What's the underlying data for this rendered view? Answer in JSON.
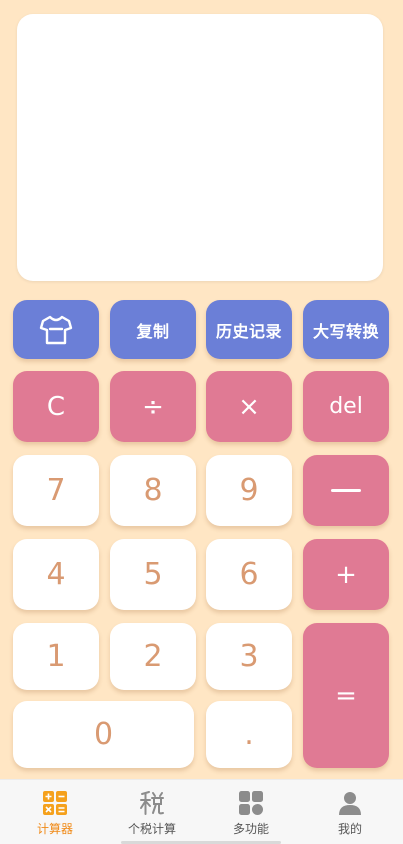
{
  "display": {
    "expression": "",
    "result": ""
  },
  "toolbar": {
    "skin_icon": "tshirt-icon",
    "copy_label": "复制",
    "history_label": "历史记录",
    "uppercase_label": "大写转换"
  },
  "keys": {
    "clear": "C",
    "divide": "÷",
    "multiply": "×",
    "delete": "del",
    "minus_icon": "minus-bar",
    "plus": "+",
    "equals": "=",
    "dot": ".",
    "digits": [
      "7",
      "8",
      "9",
      "4",
      "5",
      "6",
      "1",
      "2",
      "3",
      "0"
    ]
  },
  "tabbar": {
    "tabs": [
      {
        "label": "计算器",
        "icon": "calculator-icon",
        "active": true
      },
      {
        "label": "个税计算",
        "icon": "tax-icon",
        "active": false
      },
      {
        "label": "多功能",
        "icon": "grid-icon",
        "active": false
      },
      {
        "label": "我的",
        "icon": "user-icon",
        "active": false
      }
    ]
  },
  "colors": {
    "background": "#ffe6c4",
    "blue_key": "#6b7fd7",
    "pink_key": "#e07a94",
    "white_key_text": "#d99a72",
    "active_tab": "#f08a17"
  }
}
